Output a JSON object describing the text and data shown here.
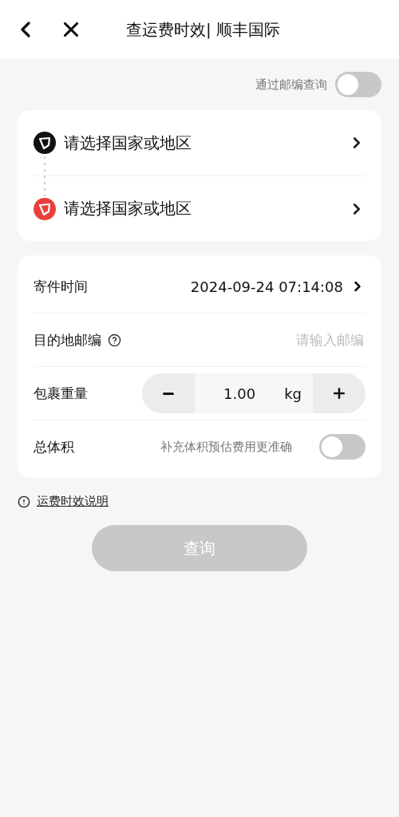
{
  "header": {
    "title": "查运费时效| 顺丰国际"
  },
  "postcode_query": {
    "label": "通过邮编查询",
    "on": false
  },
  "route": [
    {
      "kind": "origin",
      "label": "请选择国家或地区"
    },
    {
      "kind": "destination",
      "label": "请选择国家或地区"
    }
  ],
  "form": [
    {
      "kind": "datetime",
      "label": "寄件时间",
      "value": "2024-09-24 07:14:08"
    },
    {
      "kind": "input",
      "label": "目的地邮编",
      "placeholder": "请输入邮编"
    },
    {
      "kind": "stepper",
      "label": "包裹重量",
      "value": "1.00",
      "unit": "kg"
    },
    {
      "kind": "switch",
      "label": "总体积",
      "hint": "补充体积预估费用更准确",
      "on": false
    }
  ],
  "info_link": "运费时效说明",
  "query_button": {
    "label": "查询",
    "disabled": true
  }
}
